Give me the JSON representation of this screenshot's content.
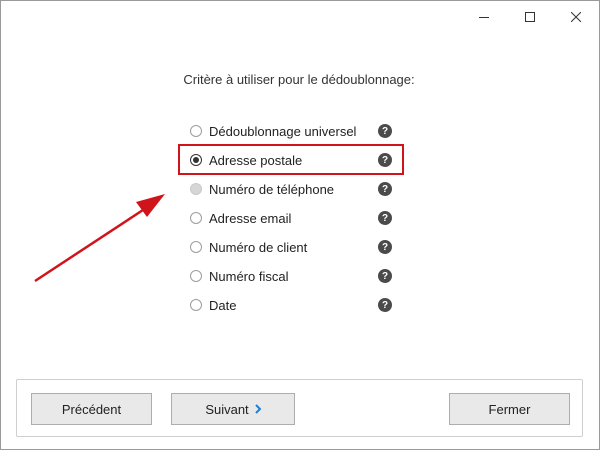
{
  "window": {
    "controls": {
      "minimize_icon": "minimize-icon",
      "maximize_icon": "maximize-icon",
      "close_icon": "close-icon"
    }
  },
  "prompt": "Critère à utiliser pour le dédoublonnage:",
  "options": [
    {
      "label": "Dédoublonnage universel",
      "state": "unchecked"
    },
    {
      "label": "Adresse postale",
      "state": "checked"
    },
    {
      "label": "Numéro de téléphone",
      "state": "disabled"
    },
    {
      "label": "Adresse email",
      "state": "unchecked"
    },
    {
      "label": "Numéro de client",
      "state": "unchecked"
    },
    {
      "label": "Numéro fiscal",
      "state": "unchecked"
    },
    {
      "label": "Date",
      "state": "unchecked"
    }
  ],
  "help_glyph": "?",
  "footer": {
    "previous_label": "Précédent",
    "next_label": "Suivant",
    "close_label": "Fermer"
  },
  "colors": {
    "highlight": "#d0141b",
    "arrow": "#d0141b",
    "next_chevron": "#1e7fd6"
  }
}
